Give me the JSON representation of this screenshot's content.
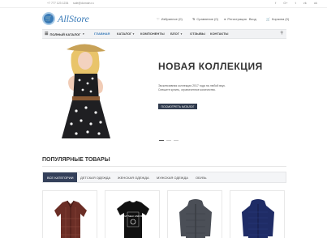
{
  "topbar": {
    "phone": "+7 777 123 1234",
    "email": "sale@domain.ru",
    "socials": [
      "f",
      "G+",
      "t",
      "vk",
      "ok"
    ]
  },
  "header": {
    "logo_text": "AllStore",
    "favorites": "Избранное (0)",
    "compare": "Сравнение (0)",
    "register": "Регистрация",
    "login": "Вход",
    "cart": "Корзина (0)"
  },
  "nav": {
    "catalog": "ПОЛНЫЙ КАТАЛОГ",
    "items": [
      "ГЛАВНАЯ",
      "КАТАЛОГ",
      "КОМПОНЕНТЫ",
      "БЛОГ",
      "ОТЗЫВЫ",
      "КОНТАКТЫ"
    ]
  },
  "hero": {
    "title": "НОВАЯ КОЛЛЕКЦИЯ",
    "subtitle_line1": "Эксклюзивная коллекция 2017 года на любой вкус.",
    "subtitle_line2": "Спешите купить, ограниченное количество.",
    "button": "ПОСМОТРЕТЬ КАТАЛОГ"
  },
  "popular": {
    "title": "ПОПУЛЯРНЫЕ ТОВАРЫ",
    "tabs": [
      "ВСЕ КАТЕГОРИИ",
      "ДЕТСКАЯ ОДЕЖДА",
      "ЖЕНСКАЯ ОДЕЖДА",
      "МУЖСКАЯ ОДЕЖДА",
      "ОБУВЬ"
    ],
    "tshirt_print": "ME MYSELF AND BIKE"
  },
  "colors": {
    "brand": "#3a7bb8",
    "dark_button": "#2f3a4d",
    "active_tab": "#34405a"
  }
}
